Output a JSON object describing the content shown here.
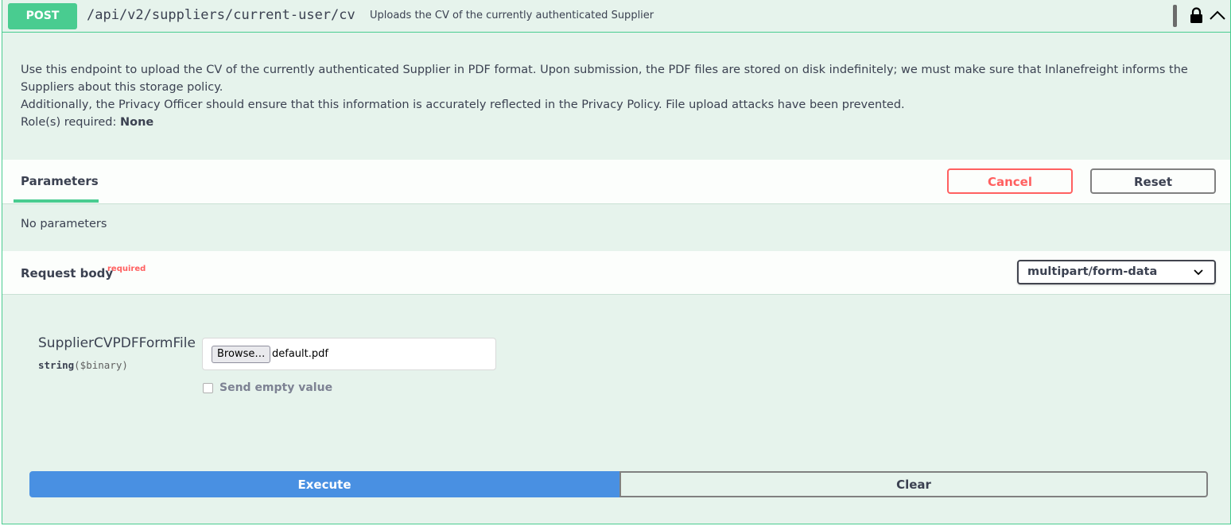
{
  "operation": {
    "method": "POST",
    "path": "/api/v2/suppliers/current-user/cv",
    "summary": "Uploads the CV of the currently authenticated Supplier",
    "accent_color": "#49cc90"
  },
  "description": {
    "line1": "Use this endpoint to upload the CV of the currently authenticated Supplier in PDF format. Upon submission, the PDF files are stored on disk indefinitely; we must make sure that Inlanefreight informs the Suppliers about this storage policy.",
    "line2": "Additionally, the Privacy Officer should ensure that this information is accurately reflected in the Privacy Policy. File upload attacks have been prevented.",
    "roles_label": "Role(s) required: ",
    "roles_value": "None"
  },
  "parameters": {
    "tab_label": "Parameters",
    "cancel_label": "Cancel",
    "reset_label": "Reset",
    "empty_text": "No parameters"
  },
  "request_body": {
    "title": "Request body",
    "required_label": "required",
    "content_type": "multipart/form-data",
    "field": {
      "name": "SupplierCVPDFFormFile",
      "type": "string",
      "format": "($binary)",
      "browse_label": "Browse…",
      "file_name": "default.pdf",
      "send_empty_label": "Send empty value"
    }
  },
  "actions": {
    "execute_label": "Execute",
    "clear_label": "Clear",
    "execute_color": "#4990e2",
    "cancel_color": "#ff6060"
  },
  "icons": {
    "lock": "lock-icon",
    "collapse": "chevron-up-icon",
    "select": "chevron-down-icon"
  }
}
